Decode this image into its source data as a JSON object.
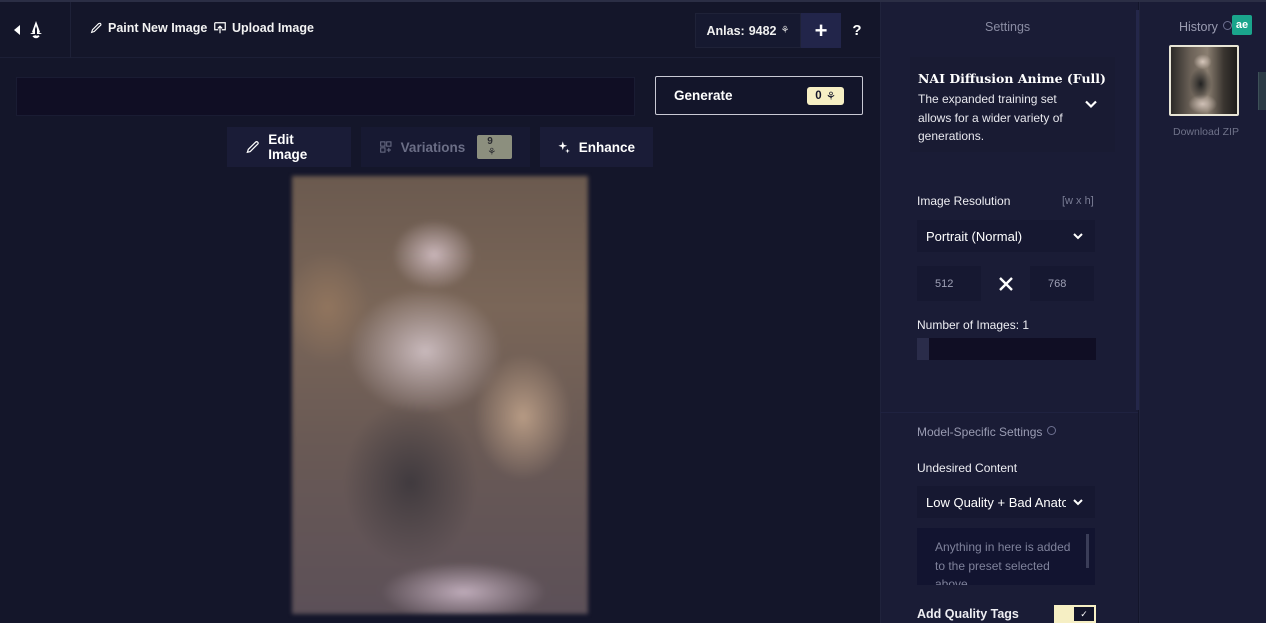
{
  "topbar": {
    "paint_new_image": "Paint New Image",
    "upload_image": "Upload Image",
    "anlas_label": "Anlas:",
    "anlas_value": "9482",
    "plus_label": "+",
    "help_label": "?"
  },
  "prompt": {
    "value": "",
    "placeholder": ""
  },
  "generate": {
    "label": "Generate",
    "cost": "0"
  },
  "actions": {
    "edit_image": "Edit Image",
    "variations": "Variations",
    "variations_cost": "9",
    "enhance": "Enhance"
  },
  "settings": {
    "title": "Settings",
    "model": {
      "name": "NAI Diffusion Anime (Full)",
      "description": "The expanded training set allows for a wider variety of generations."
    },
    "image_resolution": {
      "label": "Image Resolution",
      "hint": "[w x h]",
      "selected": "Portrait (Normal)",
      "width": "512",
      "height": "768"
    },
    "number_of_images": {
      "label": "Number of Images:",
      "value": "1"
    },
    "model_specific_label": "Model-Specific Settings",
    "undesired_content": {
      "label": "Undesired Content",
      "selected": "Low Quality + Bad Anatomy",
      "textarea_placeholder": "Anything in here is added to the preset selected above."
    },
    "add_quality_tags": {
      "label": "Add Quality Tags",
      "enabled": true,
      "check": "✓"
    }
  },
  "history": {
    "title": "History",
    "badge": "ae",
    "download_zip": "Download ZIP"
  },
  "colors": {
    "background": "#14162a",
    "panel": "#1a1c36",
    "accent_cream": "#f6efc4",
    "history_badge": "#1aa58c"
  }
}
